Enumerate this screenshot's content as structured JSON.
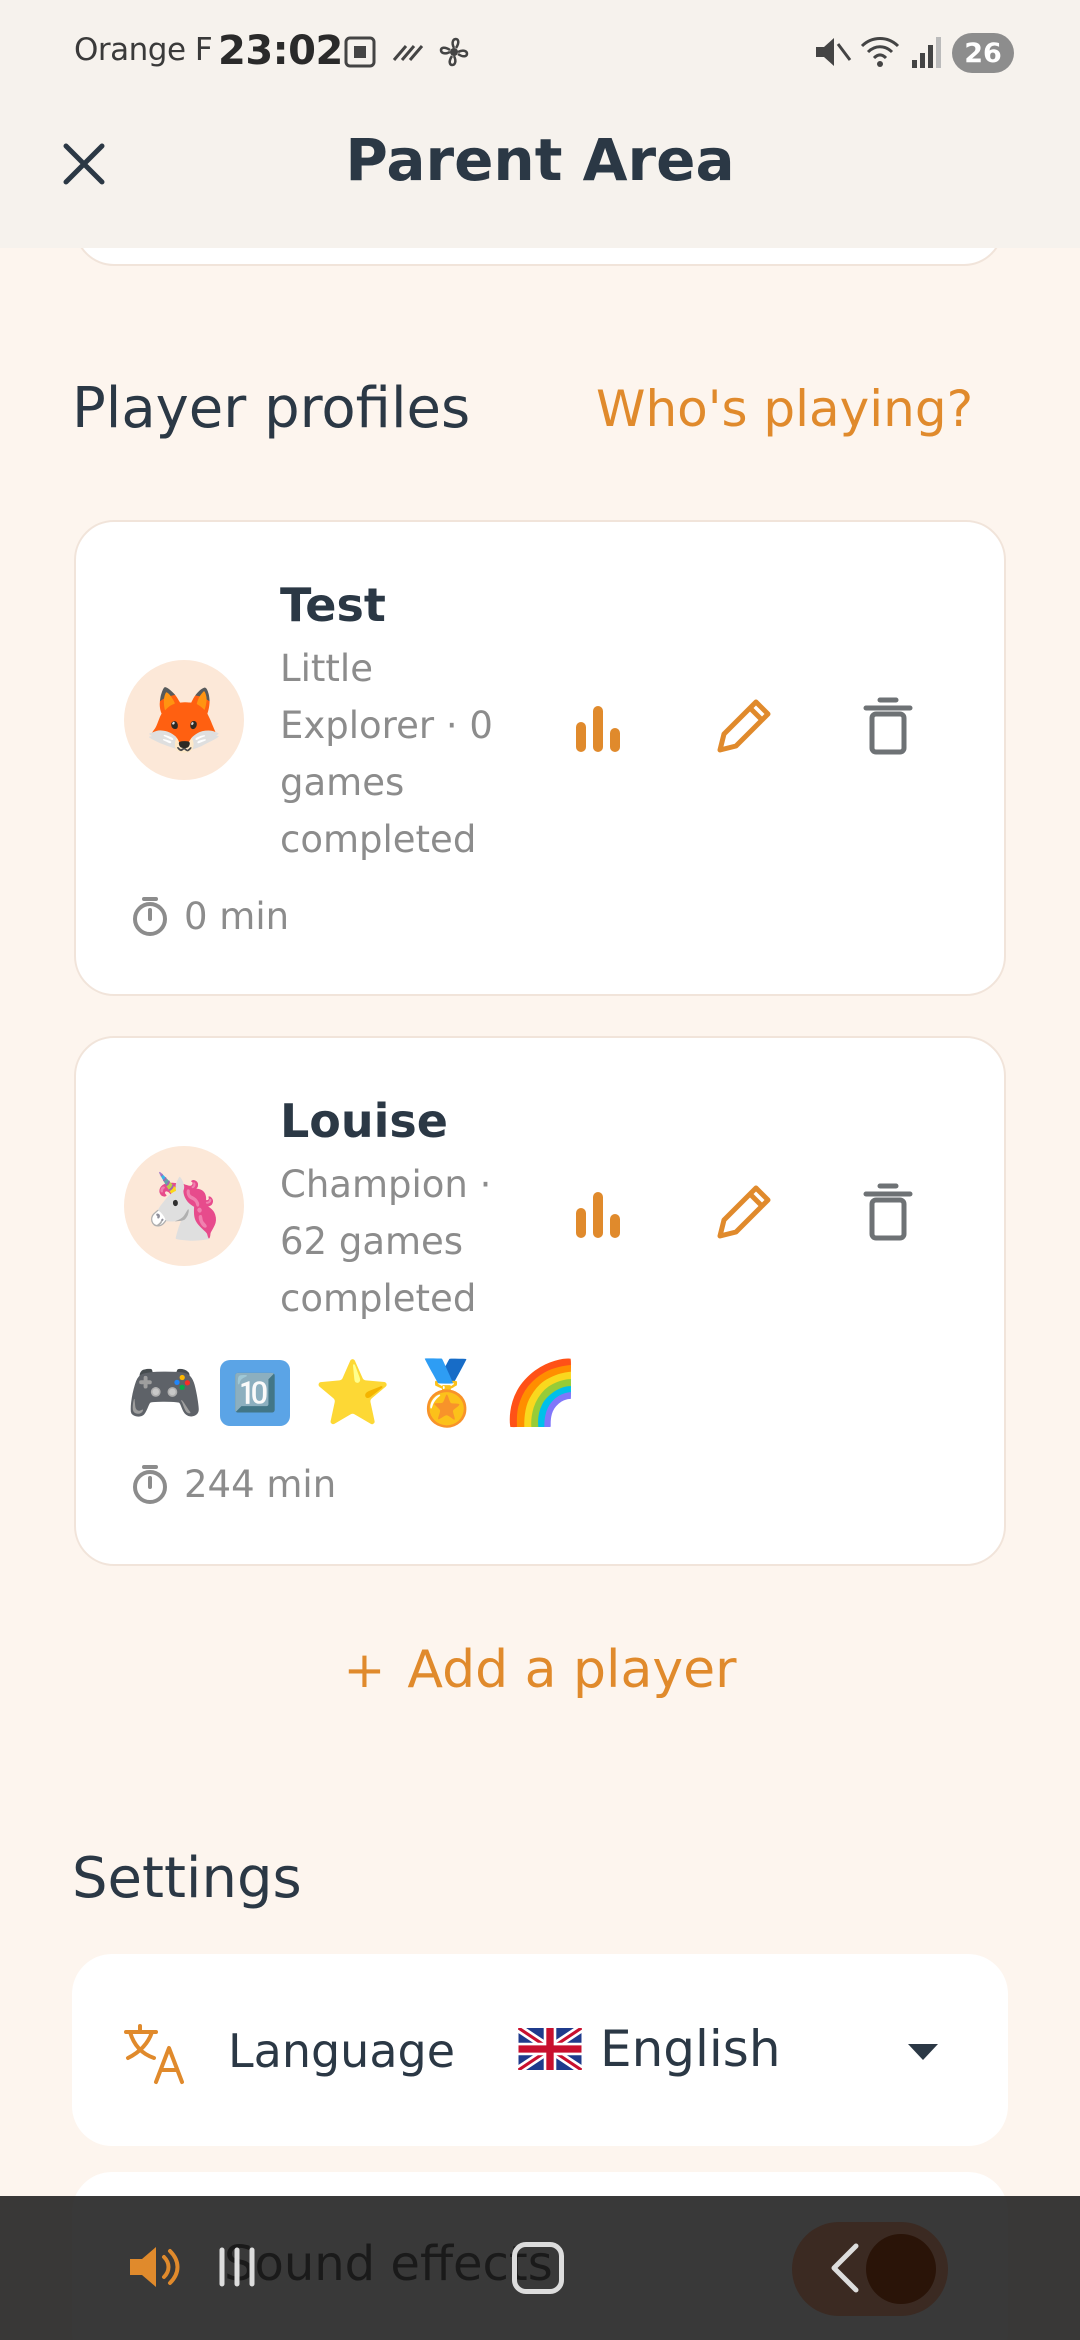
{
  "status_bar": {
    "carrier": "Orange F",
    "time": "23:02",
    "battery": "26"
  },
  "header": {
    "title": "Parent Area"
  },
  "profiles": {
    "heading": "Player profiles",
    "whos_playing": "Who's playing?",
    "players": [
      {
        "name": "Test",
        "avatar_emoji": "🦊",
        "description": "Little Explorer · 0 games completed",
        "badges": [],
        "time": "0 min"
      },
      {
        "name": "Louise",
        "avatar_emoji": "🦄",
        "description": "Champion · 62 games completed",
        "badges": [
          "🎮",
          "🔟",
          "⭐",
          "🏅",
          "🌈"
        ],
        "time": "244 min"
      }
    ],
    "add_player_plus": "+",
    "add_player": "Add a player"
  },
  "settings": {
    "heading": "Settings",
    "language_label": "Language",
    "language_value": "English",
    "sound_label": "Sound effects"
  },
  "colors": {
    "accent": "#E08A2C",
    "background": "#FDF5EE",
    "text": "#2B3845",
    "muted": "#8C8C8C"
  },
  "icons": {
    "close": "close-icon",
    "stats": "bar-chart-icon",
    "edit": "pencil-icon",
    "delete": "trash-icon",
    "timer": "stopwatch-icon",
    "language": "translate-icon",
    "sound": "speaker-icon"
  }
}
